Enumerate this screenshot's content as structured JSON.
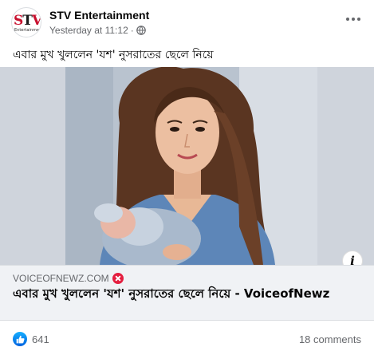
{
  "post": {
    "page_name": "STV Entertainment",
    "timestamp": "Yesterday at 11:12",
    "separator": "·",
    "privacy_icon": "globe-icon",
    "avatar_logo": "STV",
    "avatar_tagline": "Entertainment",
    "caption": "এবার মুখ খুললেন 'যশ' নুসরাতের ছেলে নিয়ে"
  },
  "link_preview": {
    "domain": "VOICEOFNEWZ.COM",
    "title": "এবার মুখ খুললেন 'যশ' নুসরাতের ছেলে নিয়ে - VoiceofNewz",
    "info_label": "i"
  },
  "footer": {
    "reaction_icon": "like-icon",
    "reaction_count": "641",
    "comments": "18 comments"
  },
  "colors": {
    "brand_blue": "#1877f2",
    "blocked_red": "#e41e3f",
    "secondary_text": "#65676b"
  }
}
